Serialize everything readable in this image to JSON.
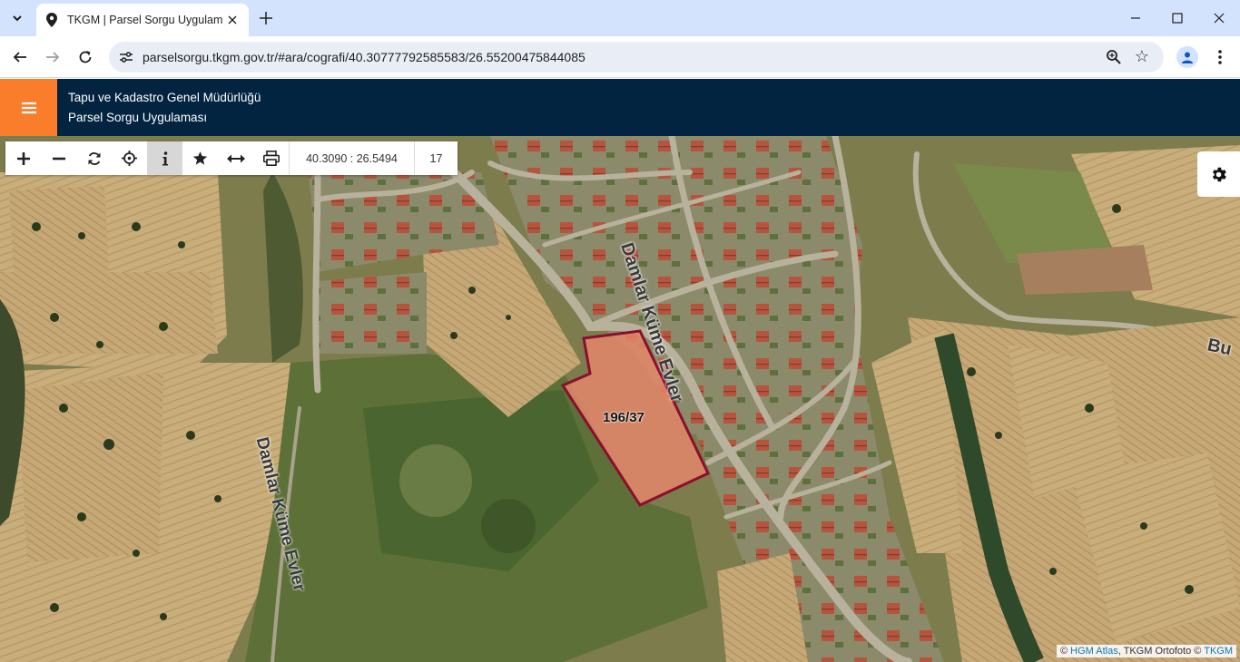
{
  "browser": {
    "tab_title": "TKGM | Parsel Sorgu Uygulaması",
    "url": "parselsorgu.tkgm.gov.tr/#ara/cografi/40.30777792585583/26.55200475844085"
  },
  "header": {
    "org_name": "Tapu ve Kadastro Genel Müdürlüğü",
    "app_name": "Parsel Sorgu Uygulaması"
  },
  "map_toolbar": {
    "coordinates": "40.3090 : 26.5494",
    "zoom_level": "17"
  },
  "map": {
    "parcel_label": "196/37",
    "road_label_1": "Damlar Küme Evler",
    "road_label_2": "Damlar Küme Evler",
    "road_label_3": "Bu",
    "parcel_fill_color": "#e8876a",
    "parcel_border_color": "#8b0f2e"
  },
  "attribution": {
    "prefix": "©",
    "hgm_link": "HGM Atlas",
    "middle": ", TKGM Ortofoto ©",
    "tkgm_link": "TKGM"
  },
  "colors": {
    "app_header": "#022440",
    "menu_button": "#f97d2b",
    "tab_strip": "#d3e3fd"
  }
}
